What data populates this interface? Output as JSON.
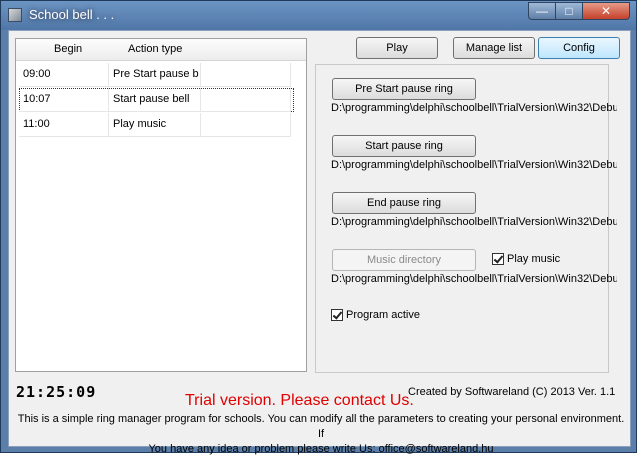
{
  "window": {
    "title": "School bell . . ."
  },
  "titlebar_buttons": {
    "minimize": "—",
    "maximize": "□",
    "close": "✕"
  },
  "toolbar": {
    "play": "Play",
    "manage_list": "Manage list",
    "config": "Config"
  },
  "grid": {
    "headers": [
      "Begin",
      "Action type"
    ],
    "rows": [
      {
        "begin": "09:00",
        "action": "Pre Start pause b",
        "extra": ""
      },
      {
        "begin": "10:07",
        "action": "Start pause bell",
        "extra": ""
      },
      {
        "begin": "11:00",
        "action": "Play music",
        "extra": ""
      }
    ],
    "selected_index": 1
  },
  "config": {
    "pre_start_button": "Pre Start pause ring",
    "pre_start_path": "D:\\programming\\delphi\\schoolbell\\TrialVersion\\Win32\\Debu",
    "start_button": "Start pause ring",
    "start_path": "D:\\programming\\delphi\\schoolbell\\TrialVersion\\Win32\\Debu",
    "end_button": "End pause ring",
    "end_path": "D:\\programming\\delphi\\schoolbell\\TrialVersion\\Win32\\Debu",
    "music_button": "Music directory",
    "music_path": "D:\\programming\\delphi\\schoolbell\\TrialVersion\\Win32\\Debu",
    "play_music_label": "Play music",
    "play_music_checked": true,
    "program_active_label": "Program active",
    "program_active_checked": true
  },
  "footer": {
    "clock": "21:25:09",
    "trial_notice": "Trial version. Please contact Us.",
    "credit": "Created by Softwareland (C) 2013   Ver. 1.1",
    "info_line1": "This is a simple ring manager program for schools. You can modify all the parameters to creating your personal environment. If",
    "info_line2": "You have any idea or problem please write Us: office@softwareland.hu"
  },
  "colors": {
    "trial_text": "#e00000",
    "titlebar": "#5b82b2",
    "config_active": "#bee6fd"
  }
}
